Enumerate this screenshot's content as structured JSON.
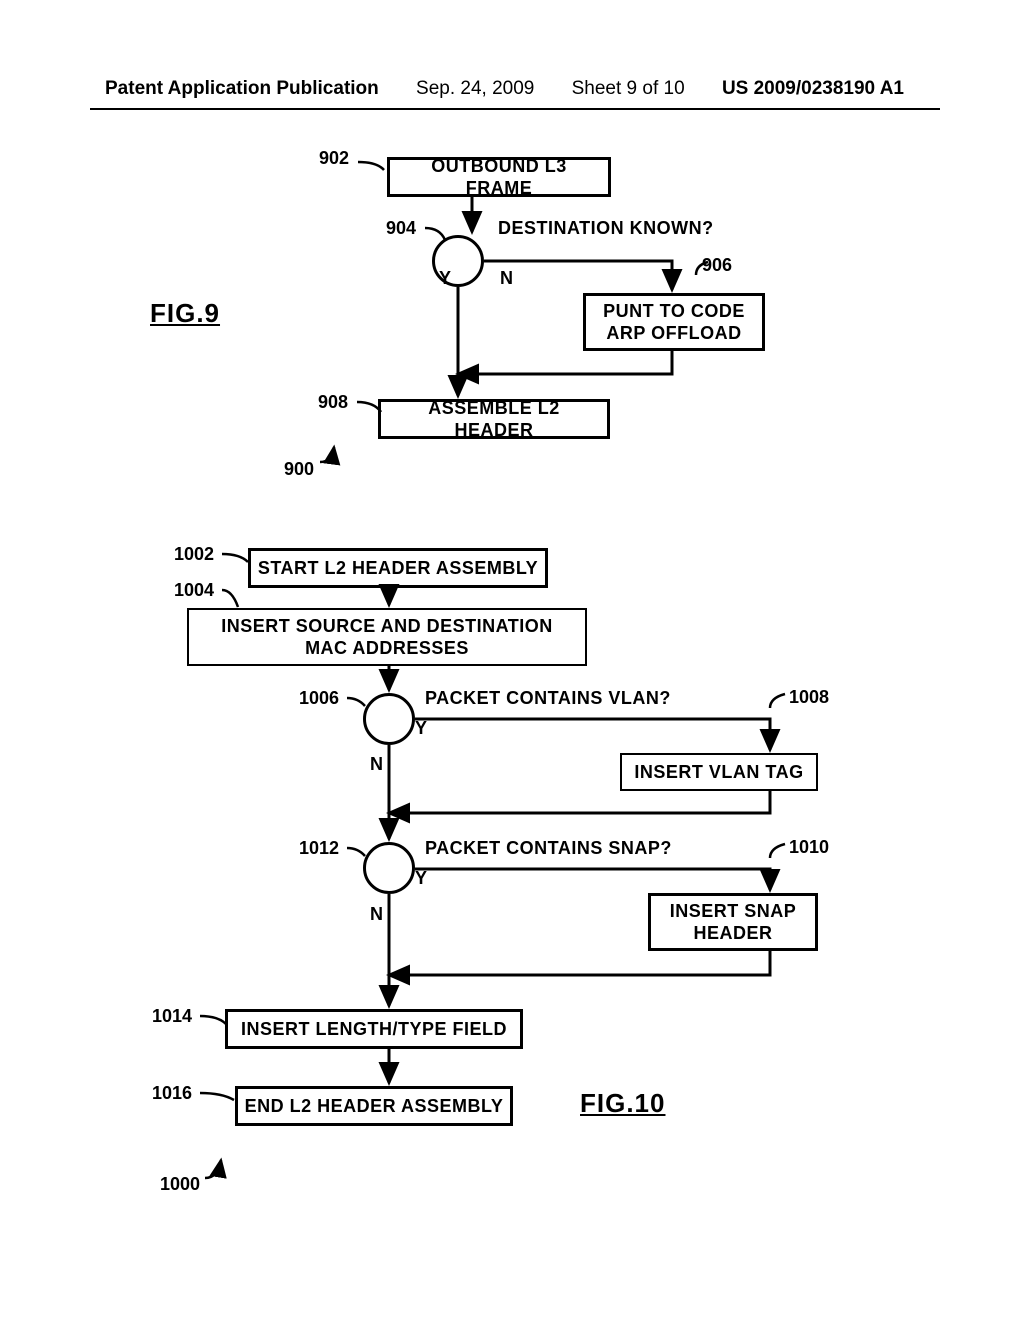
{
  "header": {
    "left": "Patent Application Publication",
    "date": "Sep. 24, 2009",
    "sheet": "Sheet 9 of 10",
    "pubno": "US 2009/0238190 A1"
  },
  "fig9": {
    "title": "FIG.9",
    "refnum": "900",
    "refs": {
      "r902": "902",
      "r904": "904",
      "r906": "906",
      "r908": "908"
    },
    "b902": "OUTBOUND L3 FRAME",
    "q904": "DESTINATION KNOWN?",
    "yn": {
      "y": "Y",
      "n": "N"
    },
    "b906_l1": "PUNT TO CODE",
    "b906_l2": "ARP OFFLOAD",
    "b908": "ASSEMBLE L2 HEADER"
  },
  "fig10": {
    "title": "FIG.10",
    "refnum": "1000",
    "refs": {
      "r1002": "1002",
      "r1004": "1004",
      "r1006": "1006",
      "r1008": "1008",
      "r1010": "1010",
      "r1012": "1012",
      "r1014": "1014",
      "r1016": "1016"
    },
    "b1002": "START L2 HEADER ASSEMBLY",
    "b1004_l1": "INSERT SOURCE AND DESTINATION",
    "b1004_l2": "MAC ADDRESSES",
    "q1006": "PACKET CONTAINS VLAN?",
    "b1008": "INSERT VLAN TAG",
    "q1012": "PACKET CONTAINS SNAP?",
    "b1010_l1": "INSERT SNAP",
    "b1010_l2": "HEADER",
    "b1014": "INSERT LENGTH/TYPE FIELD",
    "b1016": "END L2 HEADER ASSEMBLY",
    "yn": {
      "y": "Y",
      "n": "N"
    }
  }
}
